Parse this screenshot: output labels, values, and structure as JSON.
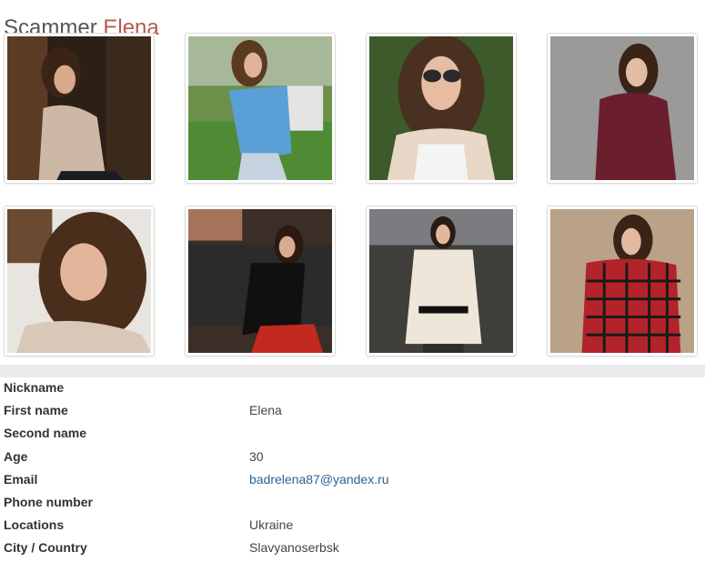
{
  "header": {
    "prefix": "Scammer",
    "name": "Elena"
  },
  "photos": [
    {
      "name": "photo-1"
    },
    {
      "name": "photo-2"
    },
    {
      "name": "photo-3"
    },
    {
      "name": "photo-4"
    },
    {
      "name": "photo-5"
    },
    {
      "name": "photo-6"
    },
    {
      "name": "photo-7"
    },
    {
      "name": "photo-8"
    }
  ],
  "profile": {
    "nickname": {
      "label": "Nickname",
      "value": ""
    },
    "first_name": {
      "label": "First name",
      "value": "Elena"
    },
    "second_name": {
      "label": "Second name",
      "value": ""
    },
    "age": {
      "label": "Age",
      "value": "30"
    },
    "email": {
      "label": "Email",
      "value": "badrelena87@yandex.ru"
    },
    "phone": {
      "label": "Phone number",
      "value": ""
    },
    "locations": {
      "label": "Locations",
      "value": "Ukraine"
    },
    "city_country": {
      "label": "City / Country",
      "value": "Slavyanoserbsk"
    }
  },
  "colors": {
    "accent_name": "#b85a4c",
    "link": "#2a6496",
    "divider": "#ebebeb"
  }
}
